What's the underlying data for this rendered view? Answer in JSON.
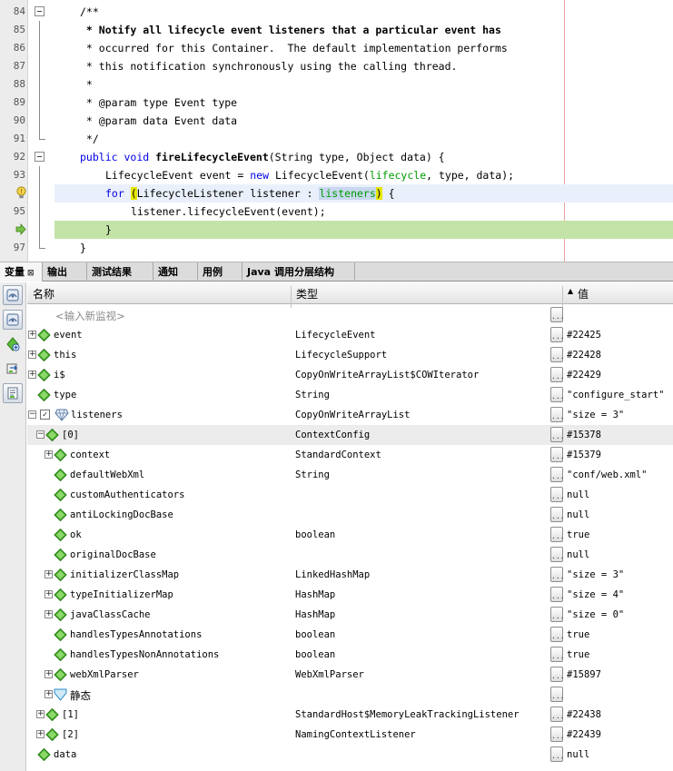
{
  "editor": {
    "lines": [
      {
        "n": "84",
        "text": "/**"
      },
      {
        "n": "85",
        "text": " * Notify all lifecycle event listeners that a particular event has"
      },
      {
        "n": "86",
        "text": " * occurred for this Container.  The default implementation performs"
      },
      {
        "n": "87",
        "text": " * this notification synchronously using the calling thread."
      },
      {
        "n": "88",
        "text": " *"
      },
      {
        "n": "89",
        "text": " * @param type Event type"
      },
      {
        "n": "90",
        "text": " * @param data Event data"
      },
      {
        "n": "91",
        "text": " */"
      },
      {
        "n": "92",
        "text": "public void fireLifecycleEvent(String type, Object data) {"
      },
      {
        "n": "93",
        "text": "LifecycleEvent event = new LifecycleEvent(lifecycle, type, data);"
      },
      {
        "n": "",
        "text": "for (LifecycleListener listener : listeners) {"
      },
      {
        "n": "95",
        "text": "listener.lifecycleEvent(event);"
      },
      {
        "n": "",
        "text": "}"
      },
      {
        "n": "97",
        "text": "}"
      }
    ],
    "colors": {
      "comment": "#969696",
      "keyword": "#0000e6",
      "field": "#009b00",
      "current_line": "#c4e3a8",
      "loop_line": "#eaf0fb",
      "bracket_highlight": "#e6e600"
    }
  },
  "tabs": [
    {
      "label": "变量",
      "close": "⊠",
      "active": true
    },
    {
      "label": "输出"
    },
    {
      "label": "测试结果"
    },
    {
      "label": "通知"
    },
    {
      "label": "用例"
    },
    {
      "label": "Java 调用分层结构"
    }
  ],
  "toolbar": {
    "icons": [
      "watch-view-icon",
      "watch-view-alt-icon",
      "new-watch-icon",
      "step-icon",
      "notes-icon"
    ]
  },
  "columns": {
    "name": "名称",
    "type": "类型",
    "value": "值",
    "sort_indicator": "▲"
  },
  "new_watch_placeholder": "<输入新监视>",
  "variables": [
    {
      "name": "event",
      "type": "LifecycleEvent",
      "value": "#22425",
      "expand": "+"
    },
    {
      "name": "this",
      "type": "LifecycleSupport",
      "value": "#22428",
      "expand": "+"
    },
    {
      "name": "i$",
      "type": "CopyOnWriteArrayList$COWIterator",
      "value": "#22429",
      "expand": "+"
    },
    {
      "name": "type",
      "type": "String",
      "value": "\"configure_start\"",
      "expand": ""
    },
    {
      "name": "listeners",
      "type": "CopyOnWriteArrayList",
      "value": "\"size = 3\"",
      "expand": "−",
      "checkbox": "✓"
    },
    {
      "name": "[0]",
      "type": "ContextConfig",
      "value": "#15378",
      "expand": "−",
      "selected": true
    },
    {
      "name": "context",
      "type": "StandardContext",
      "value": "#15379",
      "expand": "+"
    },
    {
      "name": "defaultWebXml",
      "type": "String",
      "value": "\"conf/web.xml\"",
      "expand": ""
    },
    {
      "name": "customAuthenticators",
      "type": "",
      "value": "null",
      "expand": ""
    },
    {
      "name": "antiLockingDocBase",
      "type": "",
      "value": "null",
      "expand": ""
    },
    {
      "name": "ok",
      "type": "boolean",
      "value": "true",
      "expand": ""
    },
    {
      "name": "originalDocBase",
      "type": "",
      "value": "null",
      "expand": ""
    },
    {
      "name": "initializerClassMap",
      "type": "LinkedHashMap",
      "value": "\"size = 3\"",
      "expand": "+"
    },
    {
      "name": "typeInitializerMap",
      "type": "HashMap",
      "value": "\"size = 4\"",
      "expand": "+"
    },
    {
      "name": "javaClassCache",
      "type": "HashMap",
      "value": "\"size = 0\"",
      "expand": "+"
    },
    {
      "name": "handlesTypesAnnotations",
      "type": "boolean",
      "value": "true",
      "expand": ""
    },
    {
      "name": "handlesTypesNonAnnotations",
      "type": "boolean",
      "value": "true",
      "expand": ""
    },
    {
      "name": "webXmlParser",
      "type": "WebXmlParser",
      "value": "#15897",
      "expand": "+"
    },
    {
      "name": "静态",
      "type": "",
      "value": "",
      "expand": "+"
    },
    {
      "name": "[1]",
      "type": "StandardHost$MemoryLeakTrackingListener",
      "value": "#22438",
      "expand": "+"
    },
    {
      "name": "[2]",
      "type": "NamingContextListener",
      "value": "#22439",
      "expand": "+"
    },
    {
      "name": "data",
      "type": "",
      "value": "null",
      "expand": ""
    }
  ],
  "dots_label": "...",
  "colors": {
    "variable_icon": "#4fb432",
    "selected_row": "#ececec"
  }
}
